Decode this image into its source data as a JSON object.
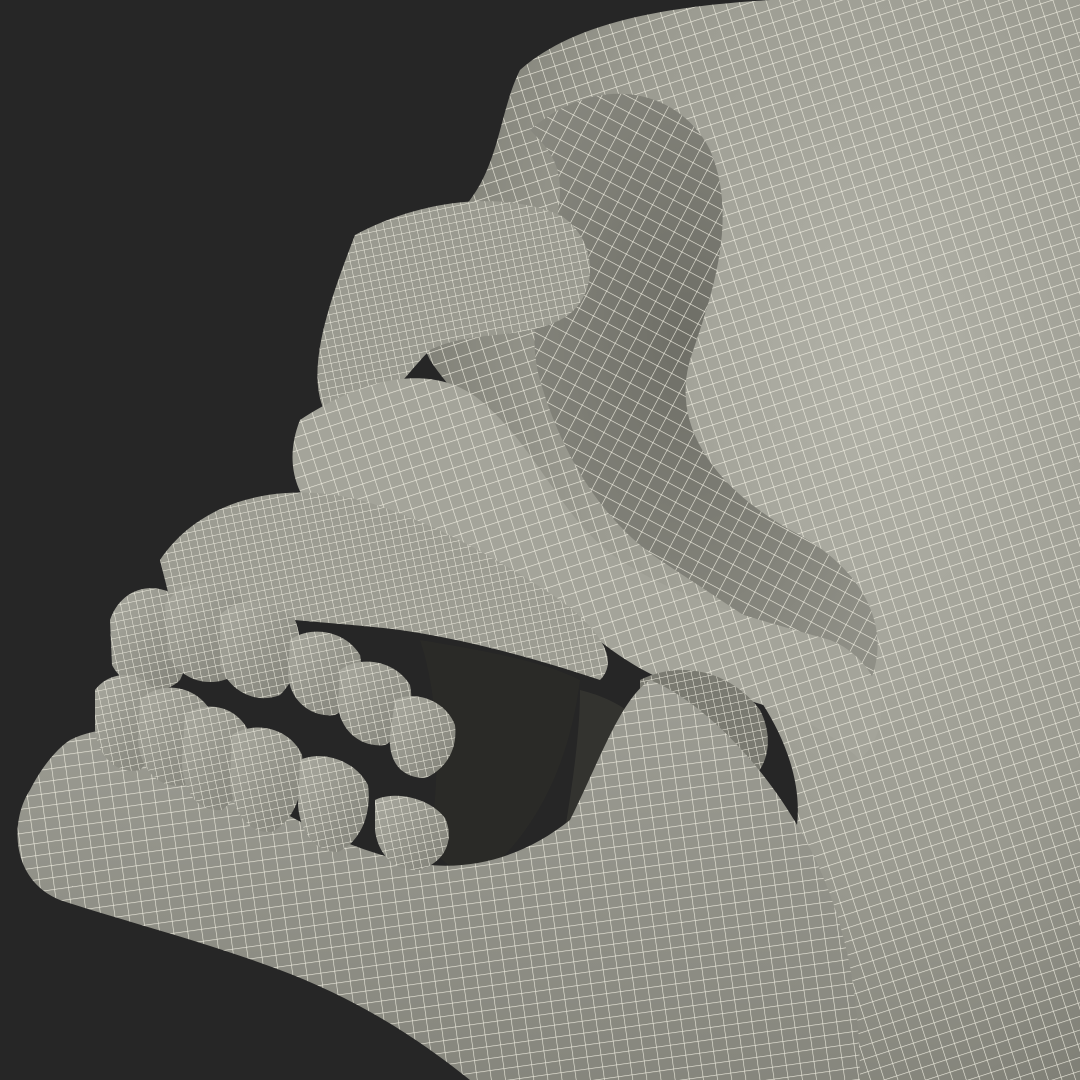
{
  "scene": {
    "subject": "skull-wireframe-render",
    "colors": {
      "background": "#262626",
      "surface_light": "#a9a99f",
      "surface_mid": "#8a8a80",
      "surface_dark": "#5f5f57",
      "cavity": "#2a2a27",
      "wire": "#f1efe2"
    }
  }
}
